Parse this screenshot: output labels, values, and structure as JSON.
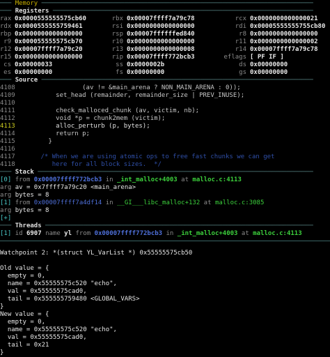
{
  "memory_header": "Memory",
  "registers_header": "Registers",
  "registers": [
    [
      [
        "rax",
        "0x0000555555575cb60"
      ],
      [
        "rbx",
        "0x00007ffff7a79c78"
      ],
      [
        "rcx",
        "0x0000000000000021"
      ]
    ],
    [
      [
        "rdx",
        "0x0000555555759461"
      ],
      [
        "rsi",
        "0x0000000000000000"
      ],
      [
        "rdi",
        "0x00005555555755cb80"
      ]
    ],
    [
      [
        "rbp",
        "0x0000000000000000"
      ],
      [
        "rsp",
        "0x00007ffffffed840"
      ],
      [
        "r8",
        "0x0000000000000000"
      ]
    ],
    [
      [
        "r9",
        "0x000055555575cb70"
      ],
      [
        "r10",
        "0x0000000000000000"
      ],
      [
        "r11",
        "0x0000000000000002"
      ]
    ],
    [
      [
        "r12",
        "0x00007ffff7a79c20"
      ],
      [
        "r13",
        "0x0000000000000008"
      ],
      [
        "r14",
        "0x00007ffff7a79c78"
      ]
    ],
    [
      [
        "r15",
        "0x0000000000000000"
      ],
      [
        "rip",
        "0x00007ffff772bcb3"
      ],
      [
        "eflags",
        "[ PF IF ]"
      ]
    ],
    [
      [
        "cs",
        "0x00000033"
      ],
      [
        "ss",
        "0x0000002b"
      ],
      [
        "ds",
        "0x00000000"
      ]
    ],
    [
      [
        "es",
        "0x00000000"
      ],
      [
        "fs",
        "0x00000000"
      ],
      [
        "gs",
        "0x00000000"
      ]
    ]
  ],
  "source_header": "Source",
  "source": [
    {
      "ln": "4108",
      "code": "                 (av != &main_arena ? NON_MAIN_ARENA : 0));",
      "type": "n"
    },
    {
      "ln": "4109",
      "code": "          set_head (remainder, remainder_size | PREV_INUSE);",
      "type": "n"
    },
    {
      "ln": "4110",
      "code": "",
      "type": "n"
    },
    {
      "ln": "4111",
      "code": "          check_malloced_chunk (av, victim, nb);",
      "type": "n"
    },
    {
      "ln": "4112",
      "code": "          void *p = chunk2mem (victim);",
      "type": "n"
    },
    {
      "ln": "4113",
      "code": "          alloc_perturb (p, bytes);",
      "type": "cur"
    },
    {
      "ln": "4114",
      "code": "          return p;",
      "type": "n"
    },
    {
      "ln": "4115",
      "code": "        }",
      "type": "n"
    },
    {
      "ln": "4116",
      "code": "",
      "type": "n"
    },
    {
      "ln": "4117",
      "code": "      /* When we are using atomic ops to free fast chunks we can get",
      "type": "cm"
    },
    {
      "ln": "4118",
      "code": "         here for all block sizes.  */",
      "type": "cm"
    }
  ],
  "stack_header": "Stack",
  "stack": [
    {
      "idx": "[0]",
      "from": "from",
      "addr": "0x00007ffff772bcb3",
      "in": "in",
      "fn": "_int_malloc+4003",
      "at": "at",
      "loc": "malloc.c:4113",
      "dim": false
    },
    {
      "arg": "arg",
      "name": "av",
      "val": "= 0x7ffff7a79c20 <main_arena>"
    },
    {
      "arg": "arg",
      "name": "bytes",
      "val": "= 8"
    },
    {
      "idx": "[1]",
      "from": "from",
      "addr": "0x00007ffff7a4df14",
      "in": "in",
      "fn": "__GI___libc_malloc+132",
      "at": "at",
      "loc": "malloc.c:3085",
      "dim": true
    },
    {
      "arg": "arg",
      "name": "bytes",
      "val": "= 8"
    },
    {
      "more": "[+]"
    }
  ],
  "threads_header": "Threads",
  "thread": {
    "idx": "[1]",
    "id": "id",
    "tid": "6907",
    "name": "name",
    "tname": "yl",
    "from": "from",
    "addr": "0x00007ffff772bcb3",
    "in": "in",
    "fn": "_int_malloc+4003",
    "at": "at",
    "loc": "malloc.c:4113"
  },
  "output": [
    "",
    "Watchpoint 2: *(struct YL_VarList *) 0x55555575cb50",
    "",
    "Old value = {",
    "  empty = 0,",
    "  name = 0x55555575c520 \"echo\",",
    "  val = 0x55555575cad0,",
    "  tail = 0x555555759480 <GLOBAL_VARS>",
    "}",
    "New value = {",
    "  empty = 0,",
    "  name = 0x55555575c520 \"echo\",",
    "  val = 0x55555575cad0,",
    "  tail = 0x21",
    "}"
  ]
}
